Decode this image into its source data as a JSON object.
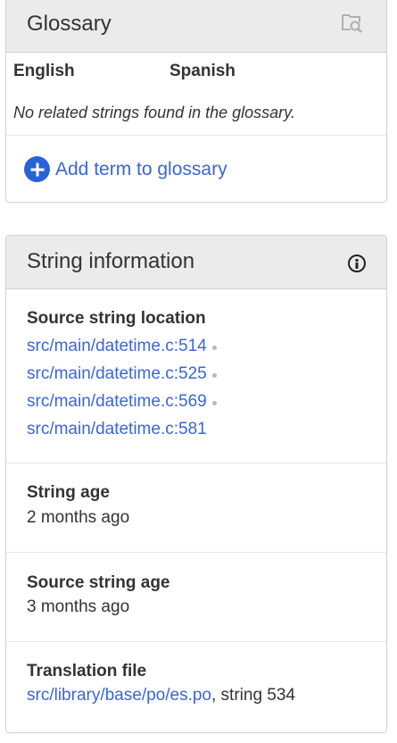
{
  "glossary": {
    "title": "Glossary",
    "col_source": "English",
    "col_target": "Spanish",
    "empty_text": "No related strings found in the glossary.",
    "add_label": "Add term to glossary",
    "accent": "#2a62d7"
  },
  "string_info": {
    "title": "String information",
    "source_location": {
      "label": "Source string location",
      "items": [
        "src/main/datetime.c:514",
        "src/main/datetime.c:525",
        "src/main/datetime.c:569",
        "src/main/datetime.c:581"
      ]
    },
    "string_age": {
      "label": "String age",
      "value": "2 months ago"
    },
    "source_string_age": {
      "label": "Source string age",
      "value": "3 months ago"
    },
    "translation_file": {
      "label": "Translation file",
      "link": "src/library/base/po/es.po",
      "suffix": ", string 534"
    }
  }
}
